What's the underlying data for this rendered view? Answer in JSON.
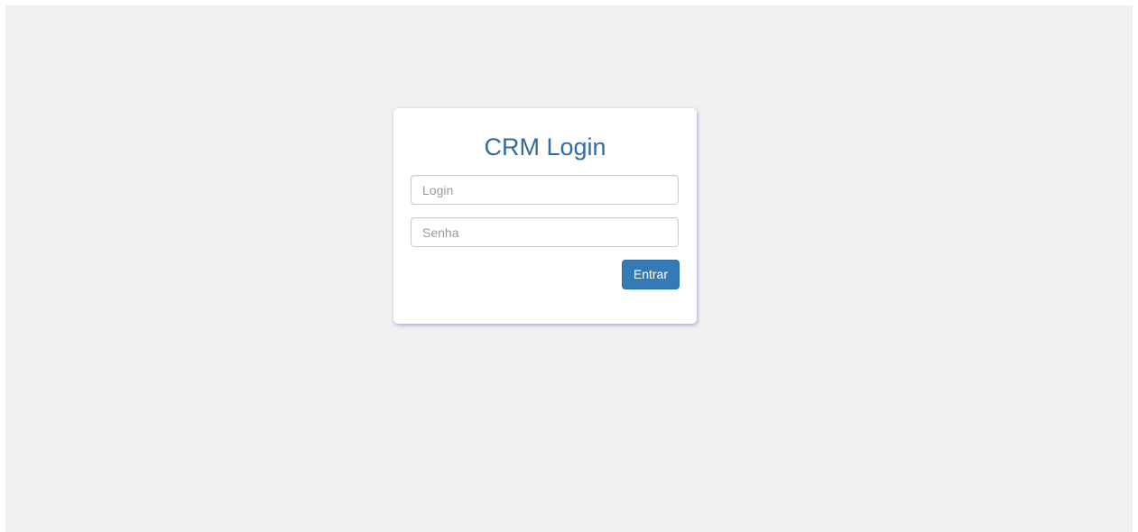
{
  "login_form": {
    "title": "CRM Login",
    "login_placeholder": "Login",
    "login_value": "",
    "password_placeholder": "Senha",
    "password_value": "",
    "submit_label": "Entrar"
  },
  "colors": {
    "page_background": "#f1f1f1",
    "title": "#336b9e",
    "primary_button": "#337ab7"
  }
}
